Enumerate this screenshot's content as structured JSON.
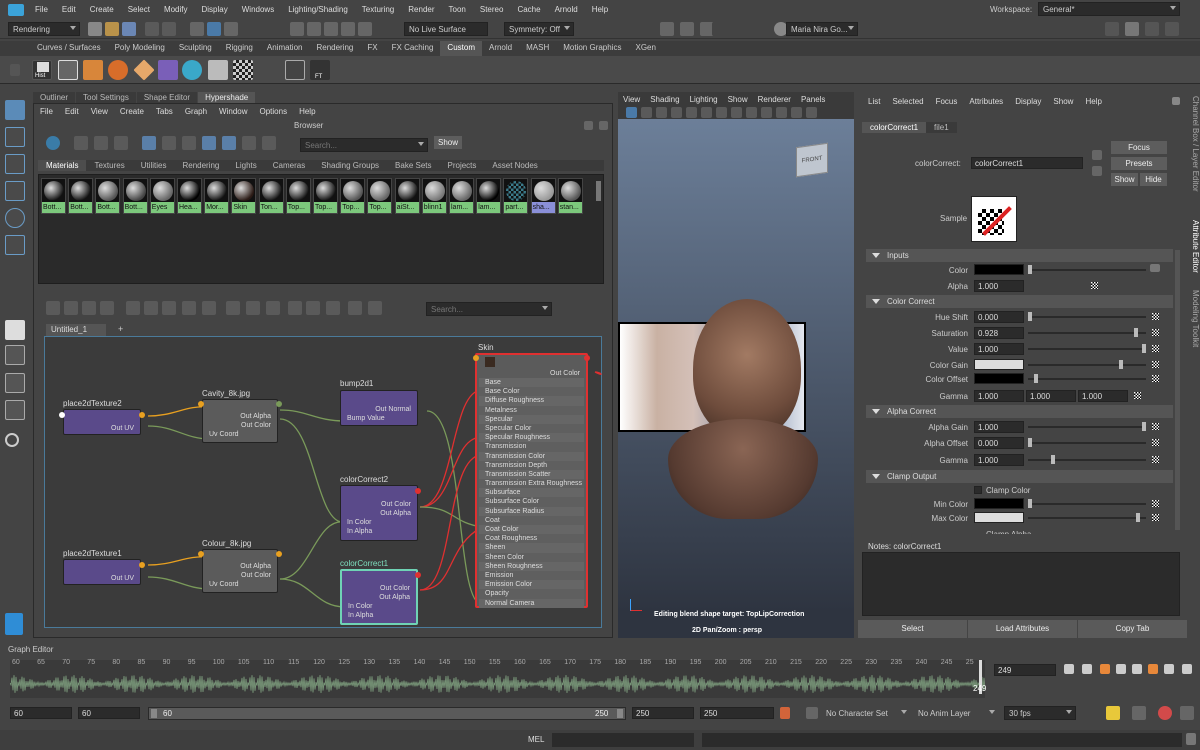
{
  "menubar": {
    "items": [
      "File",
      "Edit",
      "Create",
      "Select",
      "Modify",
      "Display",
      "Windows",
      "Lighting/Shading",
      "Texturing",
      "Render",
      "Toon",
      "Stereo",
      "Cache",
      "Arnold",
      "Help"
    ],
    "workspace_label": "Workspace:",
    "workspace_value": "General*"
  },
  "status": {
    "menuset": "Rendering",
    "live_surface": "No Live Surface",
    "symmetry": "Symmetry: Off",
    "user": "Maria Nira Go..."
  },
  "shelf_tabs": [
    "Curves / Surfaces",
    "Poly Modeling",
    "Sculpting",
    "Rigging",
    "Animation",
    "Rendering",
    "FX",
    "FX Caching",
    "Custom",
    "Arnold",
    "MASH",
    "Motion Graphics",
    "XGen"
  ],
  "shelf_active": "Custom",
  "shelf_icons": {
    "hist": "Hist",
    "ft": "FT"
  },
  "panel_tabs": [
    "Outliner",
    "Tool Settings",
    "Shape Editor",
    "Hypershade"
  ],
  "panel_active": "Hypershade",
  "hypershade": {
    "menu": [
      "File",
      "Edit",
      "View",
      "Create",
      "Tabs",
      "Graph",
      "Window",
      "Options",
      "Help"
    ],
    "browser_title": "Browser",
    "search_placeholder": "Search...",
    "show_button": "Show",
    "browser_tabs": [
      "Materials",
      "Textures",
      "Utilities",
      "Rendering",
      "Lights",
      "Cameras",
      "Shading Groups",
      "Bake Sets",
      "Projects",
      "Asset Nodes"
    ],
    "browser_active": "Materials",
    "materials": [
      "Bott...",
      "Bott...",
      "Bott...",
      "Bott...",
      "Eyes",
      "Hea...",
      "Mor...",
      "Skin",
      "Ton...",
      "Top...",
      "Top...",
      "Top...",
      "Top...",
      "aiSt...",
      "blinn1",
      "lam...",
      "lam...",
      "part...",
      "sha...",
      "stan..."
    ],
    "graph_search_placeholder": "Search...",
    "graph_tab": "Untitled_1",
    "graph_tab_add": "+",
    "nodes": {
      "place2d2": {
        "title": "place2dTexture2",
        "out": "Out UV"
      },
      "cavity": {
        "title": "Cavity_8k.jpg",
        "out_alpha": "Out Alpha",
        "out_color": "Out Color",
        "in": "Uv Coord"
      },
      "bump": {
        "title": "bump2d1",
        "out": "Out Normal",
        "in": "Bump Value"
      },
      "cc2": {
        "title": "colorCorrect2",
        "out_color": "Out Color",
        "out_alpha": "Out Alpha",
        "in_color": "In Color",
        "in_alpha": "In Alpha"
      },
      "place2d1": {
        "title": "place2dTexture1",
        "out": "Out UV"
      },
      "colour": {
        "title": "Colour_8k.jpg",
        "out_alpha": "Out Alpha",
        "out_color": "Out Color",
        "in": "Uv Coord"
      },
      "cc1": {
        "title": "colorCorrect1",
        "out_color": "Out Color",
        "out_alpha": "Out Alpha",
        "in_color": "In Color",
        "in_alpha": "In Alpha"
      },
      "skin": {
        "title": "Skin",
        "out": "Out Color",
        "attrs": [
          "Base",
          "Base Color",
          "Diffuse Roughness",
          "Metalness",
          "Specular",
          "Specular Color",
          "Specular Roughness",
          "Transmission",
          "Transmission Color",
          "Transmission Depth",
          "Transmission Scatter",
          "Transmission Extra Roughness",
          "Subsurface",
          "Subsurface Color",
          "Subsurface Radius",
          "Coat",
          "Coat Color",
          "Coat Roughness",
          "Sheen",
          "Sheen Color",
          "Sheen Roughness",
          "Emission",
          "Emission Color",
          "Opacity",
          "Normal Camera"
        ]
      }
    }
  },
  "viewport": {
    "menu": [
      "View",
      "Shading",
      "Lighting",
      "Show",
      "Renderer",
      "Panels"
    ],
    "cube_label": "FRONT",
    "hud_line1": "Editing blend shape target: TopLipCorrection",
    "hud_line2": "2D Pan/Zoom : persp"
  },
  "attr_editor": {
    "menu": [
      "List",
      "Selected",
      "Focus",
      "Attributes",
      "Display",
      "Show",
      "Help"
    ],
    "tabs": [
      "colorCorrect1",
      "file1"
    ],
    "node_label": "colorCorrect:",
    "node_value": "colorCorrect1",
    "buttons": {
      "focus": "Focus",
      "presets": "Presets",
      "show": "Show",
      "hide": "Hide"
    },
    "sample_label": "Sample",
    "sections": {
      "inputs": "Inputs",
      "color_correct": "Color Correct",
      "alpha_correct": "Alpha Correct",
      "clamp_output": "Clamp Output"
    },
    "fields": {
      "color": {
        "label": "Color",
        "swatch": "#000000"
      },
      "alpha": {
        "label": "Alpha",
        "value": "1.000"
      },
      "hue_shift": {
        "label": "Hue Shift",
        "value": "0.000",
        "level": 0.0
      },
      "saturation": {
        "label": "Saturation",
        "value": "0.928",
        "level": 0.928
      },
      "value": {
        "label": "Value",
        "value": "1.000",
        "level": 1.0
      },
      "color_gain": {
        "label": "Color Gain",
        "swatch": "#dddddd"
      },
      "color_offset": {
        "label": "Color Offset",
        "swatch": "#000000"
      },
      "gamma": {
        "label": "Gamma",
        "values": [
          "1.000",
          "1.000",
          "1.000"
        ]
      },
      "alpha_gain": {
        "label": "Alpha Gain",
        "value": "1.000",
        "level": 1.0
      },
      "alpha_offset": {
        "label": "Alpha Offset",
        "value": "0.000",
        "level": 0.0
      },
      "alpha_gamma": {
        "label": "Gamma",
        "value": "1.000"
      },
      "clamp_color": {
        "label": "Clamp Color"
      },
      "min_color": {
        "label": "Min Color",
        "swatch": "#000000"
      },
      "max_color": {
        "label": "Max Color",
        "swatch": "#dddddd"
      },
      "clamp_alpha": {
        "label": "Clamp Alpha"
      }
    },
    "notes_label": "Notes:",
    "notes_value": "colorCorrect1",
    "footer": [
      "Select",
      "Load Attributes",
      "Copy Tab"
    ],
    "side_tabs": [
      "Channel Box / Layer Editor",
      "Attribute Editor",
      "Modeling Toolkit"
    ]
  },
  "graph_editor_label": "Graph Editor",
  "timeline": {
    "ticks": [
      "60",
      "65",
      "70",
      "75",
      "80",
      "85",
      "90",
      "95",
      "100",
      "105",
      "110",
      "115",
      "120",
      "125",
      "130",
      "135",
      "140",
      "145",
      "150",
      "155",
      "160",
      "165",
      "170",
      "175",
      "180",
      "185",
      "190",
      "195",
      "200",
      "205",
      "210",
      "215",
      "220",
      "225",
      "230",
      "235",
      "240",
      "245",
      "25"
    ],
    "current_frame": "249",
    "frame_marker": "249"
  },
  "range": {
    "start": "60",
    "anim_start": "60",
    "slider_start": "60",
    "slider_end": "250",
    "anim_end": "250",
    "end": "250",
    "character_set": "No Character Set",
    "anim_layer": "No Anim Layer",
    "fps": "30 fps"
  },
  "command": {
    "label": "MEL"
  }
}
